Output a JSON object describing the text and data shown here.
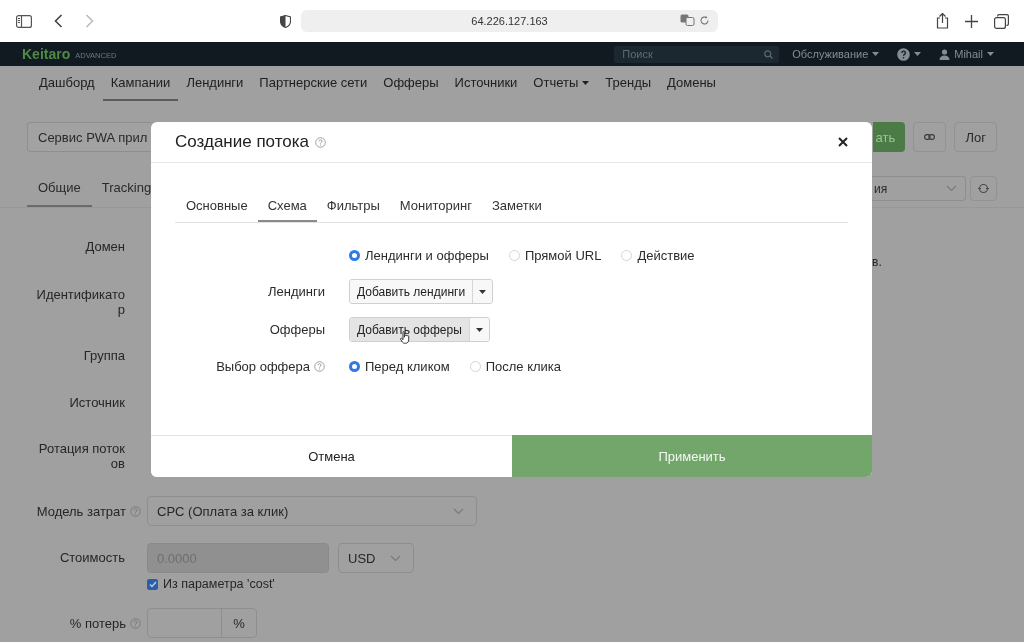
{
  "browser": {
    "url": "64.226.127.163"
  },
  "app_header": {
    "logo": "Keitaro",
    "edition": "ADVANCED",
    "search_placeholder": "Поиск",
    "menu": "Обслуживание",
    "user": "Mihail"
  },
  "nav": [
    {
      "label": "Дашборд",
      "selected": false,
      "dropdown": false
    },
    {
      "label": "Кампании",
      "selected": true,
      "dropdown": false
    },
    {
      "label": "Лендинги",
      "selected": false,
      "dropdown": false
    },
    {
      "label": "Партнерские сети",
      "selected": false,
      "dropdown": false
    },
    {
      "label": "Офферы",
      "selected": false,
      "dropdown": false
    },
    {
      "label": "Источники",
      "selected": false,
      "dropdown": false
    },
    {
      "label": "Отчеты",
      "selected": false,
      "dropdown": true
    },
    {
      "label": "Тренды",
      "selected": false,
      "dropdown": false
    },
    {
      "label": "Домены",
      "selected": false,
      "dropdown": false
    }
  ],
  "campaign": {
    "name": "Сервис PWA прил",
    "save_button": "ать",
    "log_button": "Лог",
    "tabs": [
      {
        "label": "Общие",
        "selected": true
      },
      {
        "label": "Tracking",
        "selected": false
      }
    ],
    "select_fragment": "ия",
    "note_fragment": "в.",
    "form": [
      {
        "kind": "label",
        "label": "Домен",
        "help": false
      },
      {
        "kind": "label",
        "label": "Идентификатор",
        "help": false
      },
      {
        "kind": "label",
        "label": "Группа",
        "help": false
      },
      {
        "kind": "label",
        "label": "Источник",
        "help": false
      },
      {
        "kind": "label",
        "label": "Ротация потоков",
        "help": false
      },
      {
        "kind": "select",
        "label": "Модель затрат",
        "help": true,
        "value": "CPC (Оплата за клик)"
      },
      {
        "kind": "cost",
        "label": "Стоимость",
        "help": false,
        "value": "0.0000",
        "disabled": true,
        "currency": "USD",
        "checkbox": {
          "label": "Из параметра 'cost'",
          "checked": true
        }
      },
      {
        "kind": "addon",
        "label": "% потерь",
        "help": true,
        "addon": "%"
      }
    ]
  },
  "modal": {
    "title": "Создание потока",
    "help": true,
    "tabs": [
      {
        "label": "Основные",
        "selected": false
      },
      {
        "label": "Схема",
        "selected": true
      },
      {
        "label": "Фильтры",
        "selected": false
      },
      {
        "label": "Мониторинг",
        "selected": false
      },
      {
        "label": "Заметки",
        "selected": false
      }
    ],
    "schema": [
      {
        "label": "Лендинги и офферы",
        "selected": true
      },
      {
        "label": "Прямой URL",
        "selected": false
      },
      {
        "label": "Действие",
        "selected": false
      }
    ],
    "rows": [
      {
        "label": "Лендинги",
        "button": "Добавить лендинги",
        "hovered": false
      },
      {
        "label": "Офферы",
        "button": "Добавить офферы",
        "hovered": true
      }
    ],
    "offer_choice": {
      "label": "Выбор оффера",
      "help": true,
      "options": [
        {
          "label": "Перед кликом",
          "selected": true
        },
        {
          "label": "После клика",
          "selected": false
        }
      ]
    },
    "cancel": "Отмена",
    "apply": "Применить"
  }
}
